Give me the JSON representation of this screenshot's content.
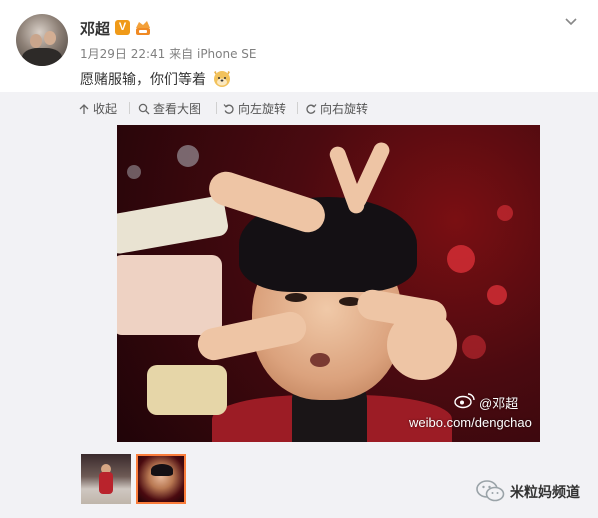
{
  "post": {
    "username": "邓超",
    "verified_badge": "V",
    "level_badge_icon": "level-badge-icon",
    "date": "1月29日 22:41",
    "source_prefix": "来自",
    "source": "iPhone SE",
    "text": "愿赌服输，你们等着"
  },
  "toolbar": {
    "collapse_label": "收起",
    "view_large_label": "查看大图",
    "rotate_left_label": "向左旋转",
    "rotate_right_label": "向右旋转"
  },
  "watermark": {
    "handle": "@邓超",
    "url": "weibo.com/dengchao"
  },
  "thumbnails": {
    "count": 2,
    "selected_index": 1
  },
  "channel": {
    "name": "米粒妈频道"
  },
  "colors": {
    "verified_badge": "#f09a18",
    "selected_thumb_border": "#fa7d3c",
    "media_background": "#f2f2f5"
  }
}
